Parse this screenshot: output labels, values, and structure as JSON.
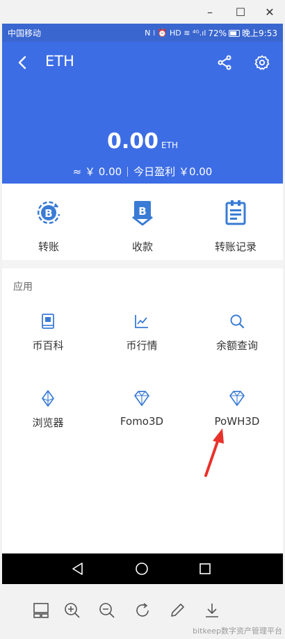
{
  "window_controls": {
    "minimize": "–",
    "maximize": "☐",
    "close": "✕"
  },
  "status_bar": {
    "carrier": "中国移动",
    "icons": "N ⁞ ⏰ HD ≋ ⁴ᴳ.ıl",
    "battery": "72%",
    "time": "晚上9:53"
  },
  "header": {
    "title": "ETH",
    "balance": "0.00",
    "unit": "ETH",
    "fiat": "≈ ￥ 0.00",
    "profit": "今日盈利 ￥0.00"
  },
  "actions": [
    {
      "label": "转账",
      "icon": "bitcoin-transfer-icon"
    },
    {
      "label": "收款",
      "icon": "bitcoin-receive-icon"
    },
    {
      "label": "转账记录",
      "icon": "clipboard-record-icon"
    }
  ],
  "apps": {
    "section_title": "应用",
    "items": [
      {
        "label": "币百科",
        "icon": "book-icon"
      },
      {
        "label": "币行情",
        "icon": "chart-icon"
      },
      {
        "label": "余额查询",
        "icon": "magnifier-icon"
      },
      {
        "label": "浏览器",
        "icon": "ethereum-icon"
      },
      {
        "label": "Fomo3D",
        "icon": "diamond-icon"
      },
      {
        "label": "PoWH3D",
        "icon": "diamond-icon"
      }
    ]
  },
  "watermark": "bitkeep数字资产管理平台",
  "colors": {
    "header": "#3d6de5",
    "accent": "#3a7bd5",
    "annotation_arrow": "#e8312a"
  }
}
